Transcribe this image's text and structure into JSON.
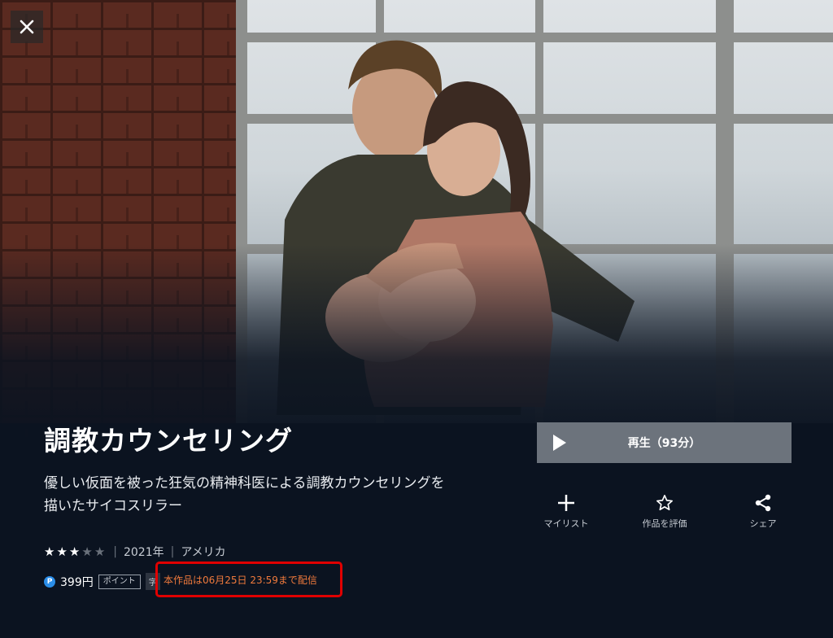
{
  "movie": {
    "title": "調教カウンセリング",
    "description": "優しい仮面を被った狂気の精神科医による調教カウンセリングを描いたサイコスリラー",
    "rating_stars": 3,
    "rating_max": 5,
    "year": "2021年",
    "country": "アメリカ",
    "price": "399円",
    "point_label": "ポイント",
    "subtitle_label": "字",
    "point_icon": "P",
    "deadline": "本作品は06月25日 23:59まで配信"
  },
  "actions": {
    "play_label": "再生（93分）",
    "mylist_label": "マイリスト",
    "rate_label": "作品を評価",
    "share_label": "シェア"
  },
  "colors": {
    "background": "#0b1320",
    "play_button": "#6c737c",
    "deadline_text": "#f07a3c",
    "highlight_border": "#e00000",
    "point_badge": "#2a8de8"
  },
  "icons": {
    "close": "close-icon",
    "play": "play-icon",
    "mylist": "plus-icon",
    "rate": "star-outline-icon",
    "share": "share-icon"
  }
}
